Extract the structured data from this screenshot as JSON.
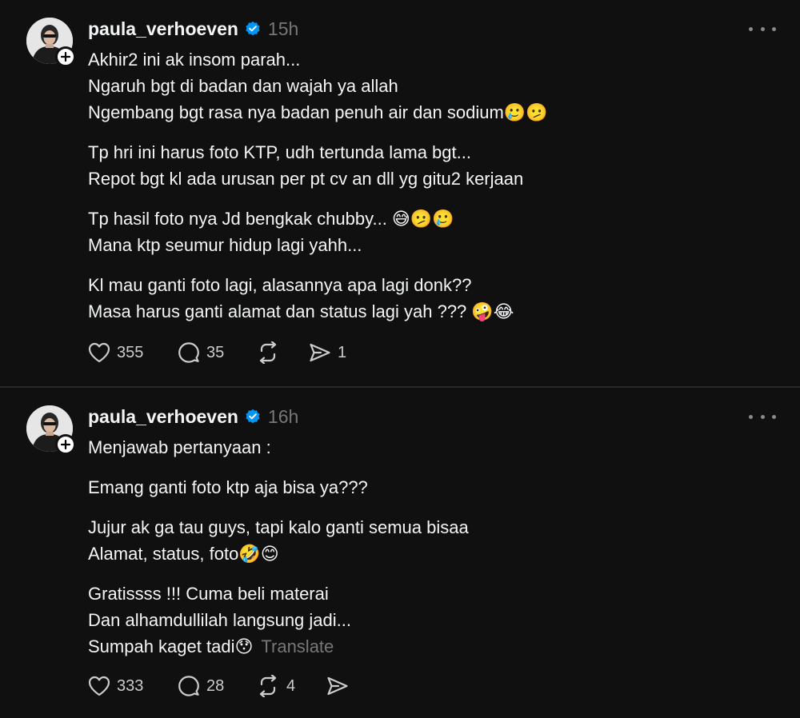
{
  "posts": [
    {
      "username": "paula_verhoeven",
      "time": "15h",
      "paragraphs": [
        [
          "Akhir2 ini ak insom parah...",
          "Ngaruh bgt di badan dan wajah ya allah",
          "Ngembang bgt rasa nya badan penuh air dan sodium🥲🫤"
        ],
        [
          "Tp hri ini harus foto KTP, udh tertunda lama bgt...",
          "Repot bgt kl ada urusan per pt cv an dll yg gitu2 kerjaan"
        ],
        [
          "Tp hasil foto nya Jd bengkak chubby... 😅🫤🥲",
          "Mana ktp seumur hidup lagi yahh..."
        ],
        [
          "Kl mau ganti foto lagi, alasannya apa lagi donk??",
          "Masa harus ganti alamat dan status lagi yah ??? 🤪😂"
        ]
      ],
      "likes": "355",
      "replies": "35",
      "reposts": "",
      "shares": "1"
    },
    {
      "username": "paula_verhoeven",
      "time": "16h",
      "paragraphs": [
        [
          "Menjawab pertanyaan :"
        ],
        [
          "Emang ganti foto ktp aja bisa ya???"
        ],
        [
          "Jujur ak ga tau guys, tapi kalo ganti semua bisaa",
          "Alamat, status, foto🤣😊"
        ],
        [
          "Gratissss !!! Cuma beli materai",
          "Dan alhamdullilah langsung jadi...",
          "Sumpah kaget tadi😯"
        ]
      ],
      "translate": "Translate",
      "likes": "333",
      "replies": "28",
      "reposts": "4",
      "shares": ""
    }
  ],
  "icons": {
    "verified": "verified-badge-icon",
    "more": "more-options-icon",
    "like": "heart-icon",
    "reply": "comment-icon",
    "repost": "repost-icon",
    "share": "share-icon",
    "follow": "plus-icon"
  },
  "colors": {
    "background": "#101010",
    "text": "#f3f5f7",
    "muted": "#777777",
    "verified": "#0095f6"
  }
}
